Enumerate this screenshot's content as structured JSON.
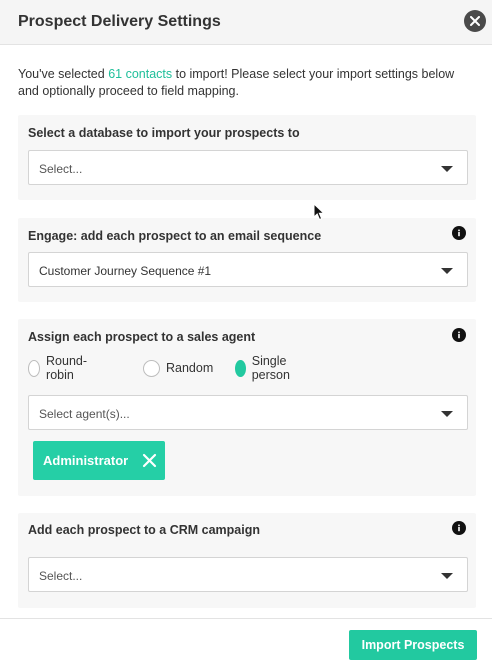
{
  "modal": {
    "title": "Prospect Delivery Settings"
  },
  "intro": {
    "prefix": "You've selected ",
    "link": "61 contacts",
    "suffix": " to import! Please select your import settings below and optionally proceed to field mapping."
  },
  "database": {
    "label": "Select a database to import your prospects to",
    "select_value": "Select..."
  },
  "engage": {
    "label": "Engage: add each prospect to an email sequence",
    "select_value": "Customer Journey Sequence #1"
  },
  "assign": {
    "label": "Assign each prospect to a sales agent",
    "options": [
      {
        "label": "Round-robin",
        "checked": false
      },
      {
        "label": "Random",
        "checked": false
      },
      {
        "label": "Single person",
        "checked": true
      }
    ],
    "select_value": "Select agent(s)...",
    "selected_agent": "Administrator"
  },
  "crm": {
    "label": "Add each prospect to a CRM campaign",
    "select_value": "Select..."
  },
  "footer": {
    "import_label": "Import Prospects"
  },
  "colors": {
    "accent": "#22c9a0",
    "chip": "#25cfa6",
    "link": "#1fbf9a"
  }
}
